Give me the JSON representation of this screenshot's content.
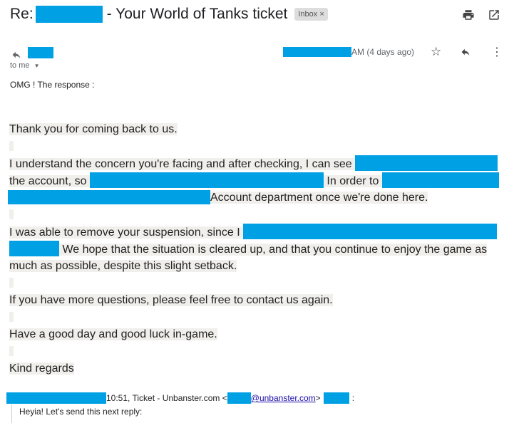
{
  "header": {
    "subject_prefix": "Re:",
    "subject_suffix": "- Your World of Tanks ticket",
    "label_chip": "Inbox",
    "label_remove": "×",
    "print_icon": "print-icon",
    "open_new_window_icon": "open-in-new-icon"
  },
  "message": {
    "recipient": "to me",
    "date_suffix": "AM (4 days ago)",
    "icons": [
      "star-icon",
      "reply-icon",
      "more-vert-icon"
    ]
  },
  "body": {
    "intro": "OMG !  The response :",
    "p1": " Thank you for coming back to us.",
    "p2_l1": "I understand the concern you're facing and after checking, I can see ",
    "p2_l2a": "the account, so ",
    "p2_l2b": " In order to ",
    "p2_l3": "Account department once we're done here.",
    "p3_l1": "I was able to remove your suspension, since I ",
    "p3_l2": " We hope that the situation is cleared up, and that you continue to enjoy the game as",
    "p3_l3": "much as possible, despite this slight setback.",
    "p4": "If you have more questions, please feel free to contact us again.",
    "p5": "Have a good day and good luck in-game.",
    "p6": "Kind regards"
  },
  "quoted": {
    "header_text": "10:51, Ticket - Unbanster.com <",
    "email_domain": "@unbanster.com",
    "header_close": ">",
    "colon": ":",
    "text": "Heyia! Let's send this next reply:"
  },
  "colors": {
    "redaction": "#00a1e4",
    "highlight": "#f1efec"
  }
}
